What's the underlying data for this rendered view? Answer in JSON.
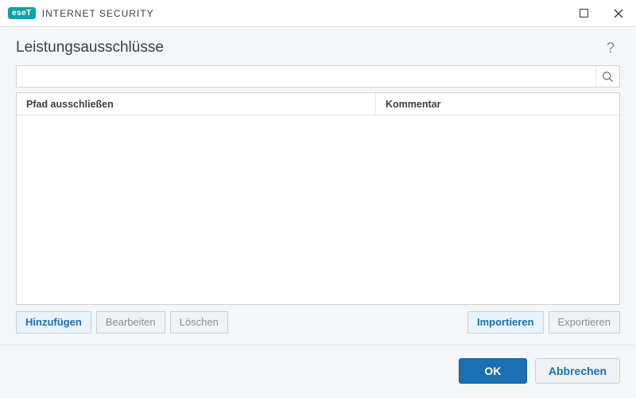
{
  "titlebar": {
    "brand_badge": "eseT",
    "brand_text": "INTERNET SECURITY"
  },
  "heading": "Leistungsausschlüsse",
  "search": {
    "placeholder": ""
  },
  "columns": {
    "path": "Pfad ausschließen",
    "comment": "Kommentar"
  },
  "actions": {
    "add": "Hinzufügen",
    "edit": "Bearbeiten",
    "delete": "Löschen",
    "import": "Importieren",
    "export": "Exportieren"
  },
  "footer": {
    "ok": "OK",
    "cancel": "Abbrechen"
  }
}
